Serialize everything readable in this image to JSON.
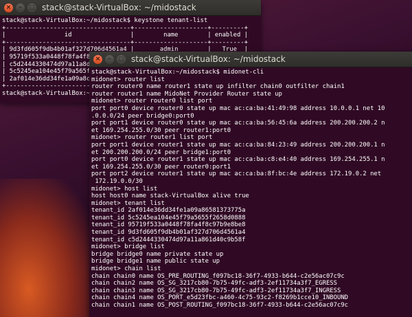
{
  "back_window": {
    "title": "stack@stack-VirtualBox: ~/midostack",
    "lines": [
      "stack@stack-VirtualBox:~/midostack$ keystone tenant-list",
      "+----------------------------------+--------------------+---------+",
      "|                id                |        name        | enabled |",
      "+----------------------------------+--------------------+---------+",
      "| 9d3fd605f9db4b01af327d706d4561a4 |       admin        |   True  |",
      "| 95719f533a0448f78fa4f8",
      "| c5d2444330474d97a11a8d",
      "| 5c5245ea104e45f79a565f",
      "| 2af014e36dd34fe1a09a8c",
      "+-------------------------",
      "stack@stack-VirtualBox:~"
    ]
  },
  "front_window": {
    "title": "stack@stack-VirtualBox: ~/midostack",
    "lines": [
      "stack@stack-VirtualBox:~/midostack$ midonet-cli",
      "midonet> router list",
      "router router0 name router1 state up infilter chain0 outfilter chain1",
      "router router1 name MidoNet Provider Router state up",
      "midonet> router router0 list port",
      "port port0 device router0 state up mac ac:ca:ba:41:49:98 address 10.0.0.1 net 10",
      ".0.0.0/24 peer bridge0:port0",
      "port port1 device router0 state up mac ac:ca:ba:56:45:6a address 200.200.200.2 n",
      "et 169.254.255.0/30 peer router1:port0",
      "midonet> router router1 list port",
      "port port1 device router1 state up mac ac:ca:ba:84:23:49 address 200.200.200.1 n",
      "et 200.200.200.0/24 peer bridge1:port0",
      "port port0 device router1 state up mac ac:ca:ba:c8:e4:40 address 169.254.255.1 n",
      "et 169.254.255.0/30 peer router0:port1",
      "port port2 device router1 state up mac ac:ca:ba:8f:bc:4e address 172.19.0.2 net",
      " 172.19.0.0/30",
      "midonet> host list",
      "host host0 name stack-VirtualBox alive true",
      "midonet> tenant list",
      "tenant_id 2af014e36dd34fe1a09a86581373775a",
      "tenant_id 5c5245ea104e45f79a5655f2658d0888",
      "tenant_id 95719f533a0448f78fa4f8c97b9e8be8",
      "tenant_id 9d3fd605f9db4b01af327d706d4561a4",
      "tenant_id c5d2444330474d97a11a861d40c9b58f",
      "midonet> bridge list",
      "bridge bridge0 name private state up",
      "bridge bridge1 name public state up",
      "midonet> chain list",
      "chain chain0 name OS_PRE_ROUTING_f097bc18-36f7-4933-b644-c2e56ac07c9c",
      "chain chain2 name OS_SG_3217cb80-7b75-49fc-adf3-2ef11734a3f7_EGRESS",
      "chain chain3 name OS_SG_3217cb80-7b75-49fc-adf3-2ef11734a3f7_INGRESS",
      "chain chain4 name OS_PORT_e5d23fbc-a460-4c75-93c2-f8269b1cce10_INBOUND",
      "chain chain1 name OS_POST_ROUTING_f097bc18-36f7-4933-b644-c2e56ac07c9c"
    ]
  }
}
